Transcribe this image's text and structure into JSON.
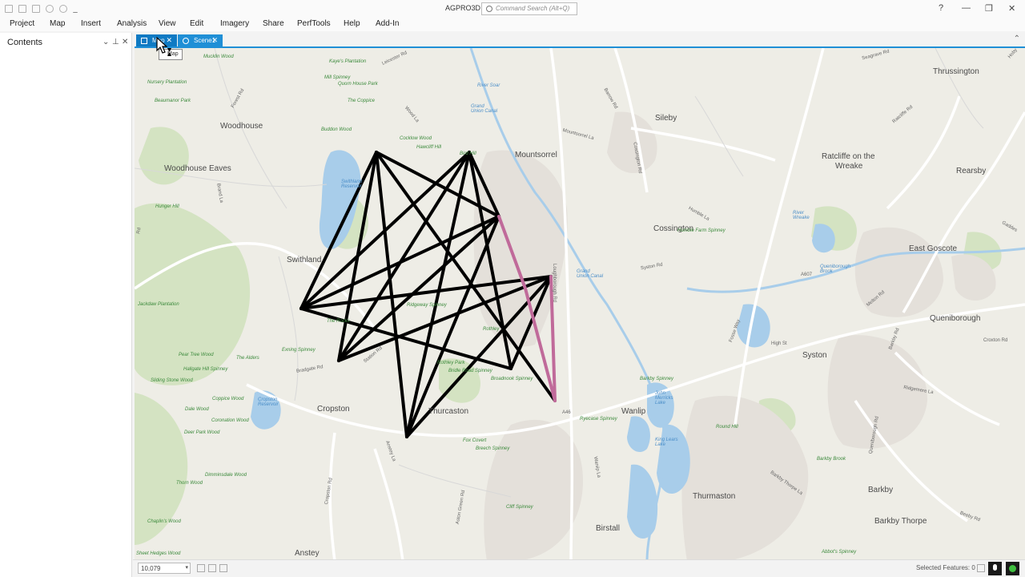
{
  "window": {
    "title": "AGPRO3D",
    "search_placeholder": "Command Search (Alt+Q)",
    "help_glyph": "?",
    "minimize_glyph": "—",
    "restore_glyph": "❐",
    "close_glyph": "✕"
  },
  "ribbon": {
    "tabs": [
      "Project",
      "Map",
      "Insert",
      "Analysis",
      "View",
      "Edit",
      "Imagery",
      "Share",
      "PerfTools",
      "Help",
      "Add-In"
    ]
  },
  "contents": {
    "title": "Contents"
  },
  "view_tabs": [
    {
      "label": "Map",
      "close": "✕",
      "icon": "map-icon"
    },
    {
      "label": "Scene1",
      "close": "✕",
      "icon": "globe-icon"
    }
  ],
  "tooltip": {
    "text": "Map"
  },
  "map": {
    "place_labels": [
      "Woodhouse",
      "Woodhouse Eaves",
      "Swithland",
      "Mountsorrel",
      "Sileby",
      "Thrussington",
      "Ratcliffe on the",
      "Wreake",
      "Rearsby",
      "Cossington",
      "East Goscote",
      "Queniborough",
      "Syston",
      "Cropston",
      "Anstey",
      "Rothley",
      "Thurcaston",
      "Wanlip",
      "Birstall",
      "Thurmaston",
      "Barkby",
      "Barkby Thorpe"
    ],
    "green_labels": [
      "Mucklin Wood",
      "Kaye's Plantation",
      "Nursery Plantation",
      "Mill Spinney",
      "Quorn House Park",
      "Beaumanor Park",
      "The Coppice",
      "Buddon Wood",
      "Cocklow Wood",
      "Hawcliff Hill",
      "Bird Hill",
      "Hunger Hill",
      "Jackdaw Plantation",
      "Pear Tree Wood",
      "Hallgate Hill Spinney",
      "Sliding Stone Wood",
      "Coppice Wood",
      "Dale Wood",
      "Coronation Wood",
      "Deer Park Wood",
      "Dimminsdale Wood",
      "Thorn Wood",
      "Chaplin's Wood",
      "Sheet Hedges Wood",
      "Humble Farm Spinney",
      "Rothley Park",
      "Bridle Road Spinney",
      "Broadnook Spinney",
      "Fox Covert",
      "Breech Spinney",
      "Ryecase Spinney",
      "Cliff Spinney",
      "Abbot's Spinney",
      "Round Hill",
      "Barkby Spinney",
      "Barkby Brook",
      "Ridgeway Spinney",
      "Exning Spinney",
      "The Alders",
      "The Rocks"
    ],
    "water_labels": [
      "River Soar",
      "Grand Union Canal",
      "Swithland Reservoir",
      "Cropston Reservoir",
      "John Merricks Lake",
      "King Lears Lake",
      "Queniborough Brook",
      "River Wreake",
      "Grand Union Canal"
    ],
    "road_labels": [
      "Leicester Rd",
      "Wood La",
      "Mountsorrel La",
      "Barrow Rd",
      "Forest Rd",
      "Brand La",
      "Rd",
      "Loughborough Rd",
      "Syston Rd",
      "A607",
      "Fosse Way",
      "A46",
      "Bradgate Rd",
      "Station Rd",
      "Anstey La",
      "Ratcliffe Rd",
      "Melton Rd",
      "Queniborough Rd",
      "Barkby Rd",
      "Ridgemere La",
      "Croxton Rd",
      "Humble La",
      "High St",
      "Cossington Rd",
      "Barkby Thorpe La",
      "Beeby Rd",
      "Cropston Rd",
      "Aston Green Rd",
      "Waniip La",
      "Seagrave Rd",
      "Hoby",
      "Gaddes"
    ]
  },
  "status_bar": {
    "scale": "10,079",
    "scale_dd": "▾",
    "selected_features": "Selected Features: 0"
  }
}
